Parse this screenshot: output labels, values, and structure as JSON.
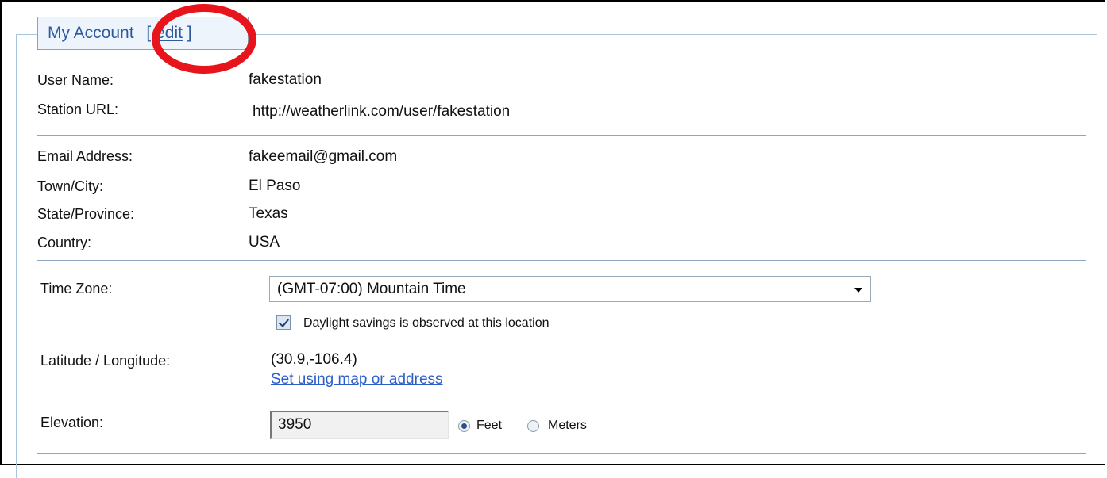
{
  "panel": {
    "title": "My Account",
    "edit_open": "[",
    "edit_link": "edit",
    "edit_close": "]"
  },
  "account": {
    "user_name_label": "User Name:",
    "user_name_value": "fakestation",
    "station_url_label": "Station URL:",
    "station_url_value": "http://weatherlink.com/user/fakestation"
  },
  "contact": {
    "email_label": "Email Address:",
    "email_value": "fakeemail@gmail.com",
    "town_label": "Town/City:",
    "town_value": "El Paso",
    "state_label": "State/Province:",
    "state_value": "Texas",
    "country_label": "Country:",
    "country_value": "USA"
  },
  "location": {
    "time_zone_label": "Time Zone:",
    "time_zone_selected": "(GMT-07:00) Mountain Time",
    "dst_checked": true,
    "dst_label": "Daylight savings is observed at this location",
    "latlon_label": "Latitude / Longitude:",
    "latlon_value": "(30.9,-106.4)",
    "set_map_link": "Set using map or address",
    "elevation_label": "Elevation:",
    "elevation_value": "3950",
    "unit_feet": "Feet",
    "unit_meters": "Meters",
    "unit_selected": "Feet"
  },
  "colors": {
    "annotation_circle": "#e8141b",
    "link": "#2d5fcc",
    "legend_text": "#2d5a9e"
  }
}
